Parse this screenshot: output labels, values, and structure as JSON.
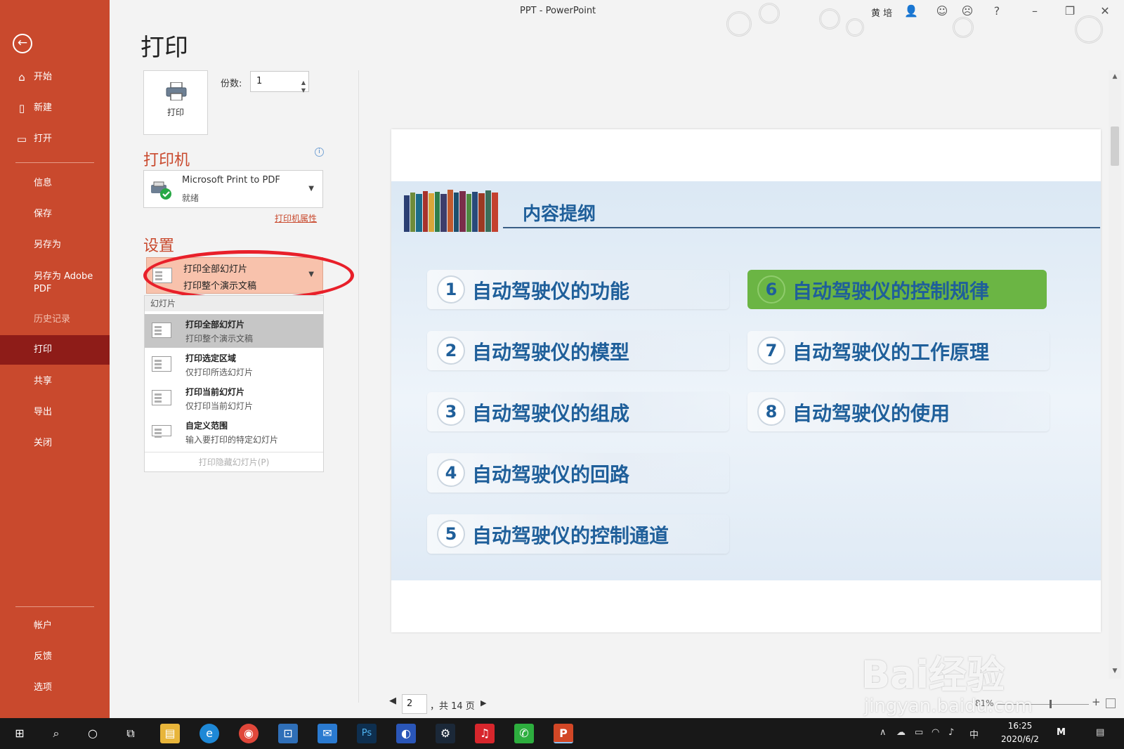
{
  "window": {
    "title": "PPT  -  PowerPoint",
    "user": "黄 培"
  },
  "sidebar": {
    "top": [
      {
        "label": "开始",
        "icon": "home-icon"
      },
      {
        "label": "新建",
        "icon": "new-file-icon"
      },
      {
        "label": "打开",
        "icon": "open-folder-icon"
      }
    ],
    "middle": [
      "信息",
      "保存",
      "另存为",
      "另存为 Adobe PDF",
      "历史记录",
      "打印",
      "共享",
      "导出",
      "关闭"
    ],
    "bottom": [
      "帐户",
      "反馈",
      "选项"
    ],
    "active": "打印"
  },
  "print": {
    "title": "打印",
    "print_button": "打印",
    "copies_label": "份数:",
    "copies_value": "1",
    "printer_heading": "打印机",
    "printer_name": "Microsoft Print to PDF",
    "printer_status": "就绪",
    "printer_properties": "打印机属性",
    "settings_heading": "设置",
    "selected_line1": "打印全部幻灯片",
    "selected_line2": "打印整个演示文稿",
    "dropdown_header": "幻灯片",
    "dropdown_items": [
      {
        "title": "打印全部幻灯片",
        "desc": "打印整个演示文稿"
      },
      {
        "title": "打印选定区域",
        "desc": "仅打印所选幻灯片"
      },
      {
        "title": "打印当前幻灯片",
        "desc": "仅打印当前幻灯片"
      },
      {
        "title": "自定义范围",
        "desc": "输入要打印的特定幻灯片"
      }
    ],
    "dropdown_footer": "打印隐藏幻灯片(P)"
  },
  "slide": {
    "heading": "内容提纲",
    "items": [
      {
        "num": "1",
        "text": "自动驾驶仪的功能"
      },
      {
        "num": "2",
        "text": "自动驾驶仪的模型"
      },
      {
        "num": "3",
        "text": "自动驾驶仪的组成"
      },
      {
        "num": "4",
        "text": "自动驾驶仪的回路"
      },
      {
        "num": "5",
        "text": "自动驾驶仪的控制通道"
      },
      {
        "num": "6",
        "text": "自动驾驶仪的控制规律"
      },
      {
        "num": "7",
        "text": "自动驾驶仪的工作原理"
      },
      {
        "num": "8",
        "text": "自动驾驶仪的使用"
      }
    ],
    "highlight_color": "#6bb544",
    "text_color": "#1f5f9a"
  },
  "pager": {
    "current": "2",
    "total": "，共 14 页",
    "zoom": "81%",
    "zoom_level": 0.81
  },
  "watermark": {
    "brand": "Bai经验",
    "url": "jingyan.baidu.com"
  },
  "taskbar": {
    "time": "16:25",
    "date": "2020/6/2",
    "ime": "中",
    "apps": [
      "start-icon",
      "search-icon",
      "cortana-icon",
      "task-view-icon",
      "file-explorer-icon",
      "edge-icon",
      "chrome-icon",
      "store-icon",
      "mail-icon",
      "photoshop-icon",
      "browser-icon",
      "steam-icon",
      "netease-music-icon",
      "wechat-icon",
      "powerpoint-icon"
    ]
  },
  "colors": {
    "sidebar": "#c9492d",
    "active_nav": "#8e1c18",
    "accent": "#c9492d",
    "annotation": "#e8202a"
  }
}
